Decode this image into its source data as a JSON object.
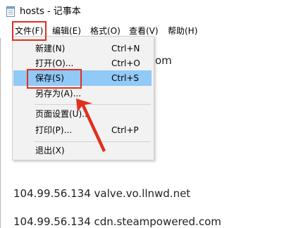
{
  "window": {
    "title": "hosts - 记事本",
    "icon": "notepad-icon"
  },
  "menubar": {
    "items": [
      {
        "label": "文件(F)"
      },
      {
        "label": "编辑(E)"
      },
      {
        "label": "格式(O)"
      },
      {
        "label": "查看(V)"
      },
      {
        "label": "帮助(H)"
      }
    ]
  },
  "file_menu": {
    "items": [
      {
        "label": "新建(N)",
        "shortcut": "Ctrl+N"
      },
      {
        "label": "打开(O)...",
        "shortcut": "Ctrl+O"
      },
      {
        "label": "保存(S)",
        "shortcut": "Ctrl+S",
        "selected": true
      },
      {
        "label": "另存为(A)...",
        "shortcut": ""
      },
      {
        "label": "页面设置(U)...",
        "shortcut": ""
      },
      {
        "label": "打印(P)...",
        "shortcut": "Ctrl+P"
      },
      {
        "label": "退出(X)",
        "shortcut": ""
      }
    ]
  },
  "editor": {
    "partial_text": "om",
    "lines": [
      "104.99.56.134 valve.vo.llnwd.net",
      "104.99.56.134 cdn.steampowered.com"
    ]
  },
  "annotation": {
    "color": "#e0301e",
    "highlight_color": "#91c9f7"
  }
}
